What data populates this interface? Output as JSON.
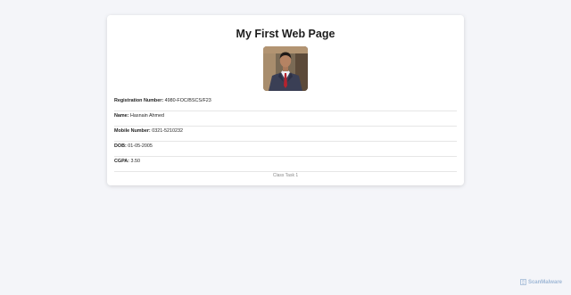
{
  "page": {
    "title": "My First Web Page",
    "footer": "Class Task 1"
  },
  "profile": {
    "photo_alt": "profile-photo",
    "fields": [
      {
        "label": "Registration Number:",
        "value": "4980-FOC/BSCS/F23"
      },
      {
        "label": "Name:",
        "value": "Hasnain Ahmed"
      },
      {
        "label": "Mobile Number:",
        "value": "0321-5210232"
      },
      {
        "label": "DOB:",
        "value": "01-05-2005"
      },
      {
        "label": "CGPA:",
        "value": "3.50"
      }
    ]
  },
  "watermark": {
    "text": "ScanMalware",
    "icon": "scanmalware-logo-icon"
  },
  "colors": {
    "background": "#f4f5f9",
    "card": "#ffffff",
    "divider": "#e6e6e6",
    "watermark": "#9fb8d6"
  }
}
